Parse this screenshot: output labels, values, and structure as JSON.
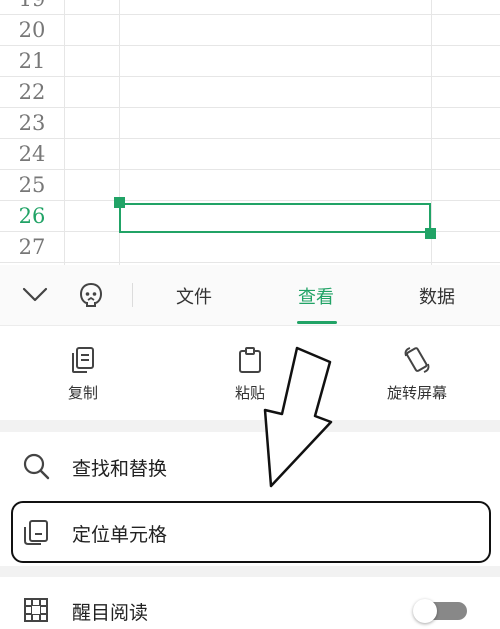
{
  "sheet": {
    "rows": [
      {
        "num": "19",
        "active": false
      },
      {
        "num": "20",
        "active": false
      },
      {
        "num": "21",
        "active": false
      },
      {
        "num": "22",
        "active": false
      },
      {
        "num": "23",
        "active": false
      },
      {
        "num": "24",
        "active": false
      },
      {
        "num": "25",
        "active": false
      },
      {
        "num": "26",
        "active": true
      },
      {
        "num": "27",
        "active": false
      }
    ],
    "selected_row": "26"
  },
  "tabbar": {
    "tabs": [
      {
        "label": "文件",
        "active": false
      },
      {
        "label": "查看",
        "active": true
      },
      {
        "label": "数据",
        "active": false
      }
    ]
  },
  "quick_actions": [
    {
      "label": "复制",
      "icon": "copy-icon"
    },
    {
      "label": "粘贴",
      "icon": "paste-icon"
    },
    {
      "label": "旋转屏幕",
      "icon": "rotate-screen-icon"
    }
  ],
  "menu": {
    "find_replace": "查找和替换",
    "locate_cell": "定位单元格",
    "eye_reading": "醒目阅读",
    "eye_reading_enabled": false
  },
  "colors": {
    "accent": "#21a366",
    "annotation": "#111111"
  }
}
